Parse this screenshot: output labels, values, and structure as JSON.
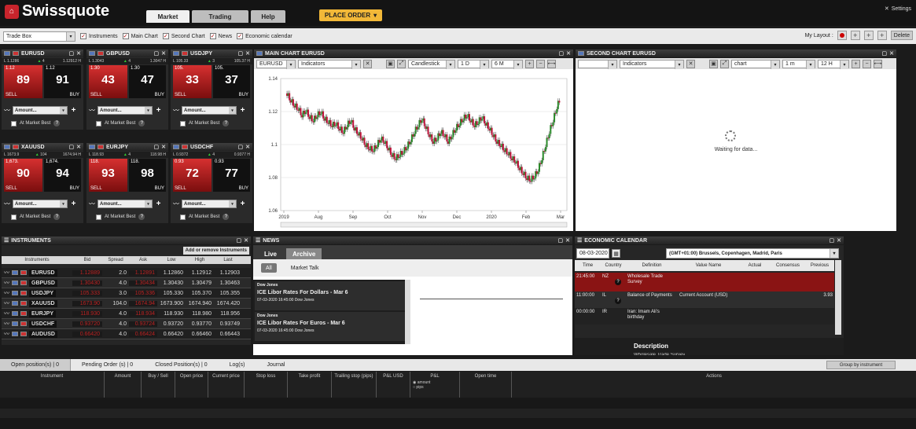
{
  "app": {
    "brand": "Swissquote",
    "settings": "Settings"
  },
  "nav": {
    "tabs": [
      "Market",
      "Trading",
      "Help"
    ],
    "place_order": "PLACE ORDER"
  },
  "toolbar": {
    "tradebox": "Trade Box",
    "checks": [
      "Instruments",
      "Main Chart",
      "Second Chart",
      "News",
      "Economic calendar"
    ],
    "my_layout": "My Layout :",
    "delete": "Delete"
  },
  "tiles": [
    {
      "pair": "EURUSD",
      "low": "L 1.1286",
      "mid": "4",
      "high": "1.12912 H",
      "sell_small": "1.12",
      "sell_big": "89",
      "buy_small": "1.12",
      "buy_big": "91",
      "sell": "SELL",
      "buy": "BUY",
      "amount": "Amount...",
      "mb": "At Market Best"
    },
    {
      "pair": "GBPUSD",
      "low": "L 1.3043",
      "mid": "4",
      "high": "1.3047 H",
      "sell_small": "1.30",
      "sell_big": "43",
      "buy_small": "1.30",
      "buy_big": "47",
      "sell": "SELL",
      "buy": "BUY",
      "amount": "Amount...",
      "mb": "At Market Best"
    },
    {
      "pair": "USDJPY",
      "low": "L 105.33",
      "mid": "3",
      "high": "105.37 H",
      "sell_small": "105.",
      "sell_big": "33",
      "buy_small": "105.",
      "buy_big": "37",
      "sell": "SELL",
      "buy": "BUY",
      "amount": "Amount...",
      "mb": "At Market Best"
    },
    {
      "pair": "XAUUSD",
      "low": "L 1673.9",
      "mid": "104",
      "high": "1674.94 H",
      "sell_small": "1,673.",
      "sell_big": "90",
      "buy_small": "1,674.",
      "buy_big": "94",
      "sell": "SELL",
      "buy": "BUY",
      "amount": "Amount...",
      "mb": "At Market Best"
    },
    {
      "pair": "EURJPY",
      "low": "L 118.93",
      "mid": "4",
      "high": "118.98 H",
      "sell_small": "118.",
      "sell_big": "93",
      "buy_small": "118.",
      "buy_big": "98",
      "sell": "SELL",
      "buy": "BUY",
      "amount": "Amount...",
      "mb": "At Market Best"
    },
    {
      "pair": "USDCHF",
      "low": "L 0.9372",
      "mid": "4",
      "high": "0.9377 H",
      "sell_small": "0.93",
      "sell_big": "72",
      "buy_small": "0.93",
      "buy_big": "77",
      "sell": "SELL",
      "buy": "BUY",
      "amount": "Amount...",
      "mb": "At Market Best"
    }
  ],
  "main_chart": {
    "title": "MAIN CHART EURUSD",
    "instrument": "EURUSD",
    "indicators": "Indicators",
    "type": "Candlestick",
    "interval": "1 D",
    "range": "6 M",
    "yticks": [
      "1.14",
      "1.12",
      "1.1",
      "1.08",
      "1.06"
    ],
    "xticks": [
      "2019",
      "Aug",
      "Sep",
      "Oct",
      "Nov",
      "Dec",
      "2020",
      "Feb",
      "Mar"
    ]
  },
  "second_chart": {
    "title": "SECOND CHART EURUSD",
    "indicators": "Indicators",
    "type": "chart",
    "interval": "1 m",
    "range": "12 H",
    "waiting": "Waiting for data..."
  },
  "instruments": {
    "title": "INSTRUMENTS",
    "add_remove": "Add or remove Instruments",
    "headers": [
      "Instruments",
      "Bid",
      "Spread",
      "Ask",
      "Low",
      "High",
      "Last"
    ],
    "rows": [
      [
        "EURUSD",
        "1.12889",
        "2.0",
        "1.12891",
        "1.12860",
        "1.12912",
        "1.12903"
      ],
      [
        "GBPUSD",
        "1.30430",
        "4.0",
        "1.30434",
        "1.30430",
        "1.30479",
        "1.30463"
      ],
      [
        "USDJPY",
        "105.333",
        "3.0",
        "105.336",
        "105.330",
        "105.370",
        "105.355"
      ],
      [
        "XAUUSD",
        "1673.90",
        "104.0",
        "1674.94",
        "1673.900",
        "1674.940",
        "1674.420"
      ],
      [
        "EURJPY",
        "118.930",
        "4.0",
        "118.934",
        "118.930",
        "118.980",
        "118.956"
      ],
      [
        "USDCHF",
        "0.93720",
        "4.0",
        "0.93724",
        "0.93720",
        "0.93770",
        "0.93749"
      ],
      [
        "AUDUSD",
        "0.66420",
        "4.0",
        "0.66424",
        "0.66420",
        "0.66460",
        "0.66443"
      ]
    ]
  },
  "news": {
    "title": "NEWS",
    "tabs": [
      "Live",
      "Archive"
    ],
    "filters": [
      "All",
      "Market Talk"
    ],
    "items": [
      {
        "source": "Dow Jones",
        "headline": "ICE Libor Rates For Dollars - Mar 6",
        "meta": "07-03-2020 16:45:00  Dow Jones"
      },
      {
        "source": "Dow Jones",
        "headline": "ICE Libor Rates For Euros - Mar 6",
        "meta": "07-03-2020 16:45:00  Dow Jones"
      }
    ]
  },
  "calendar": {
    "title": "ECONOMIC CALENDAR",
    "date": "08-03-2020",
    "timezone": "(GMT+01:00) Brussels, Copenhagen, Madrid, Paris",
    "headers": [
      "Time",
      "Country",
      "Definition",
      "Value Name",
      "Actual",
      "Consensus",
      "Previous"
    ],
    "rows": [
      {
        "time": "21:45:00",
        "country": "NZ",
        "definition": "Wholesale Trade Survey",
        "value": "",
        "actual": "",
        "consensus": "",
        "previous": "",
        "q": "?"
      },
      {
        "time": "11:00:00",
        "country": "IL",
        "definition": "Balance of Payments",
        "value": "Current Account (USD)",
        "actual": "",
        "consensus": "",
        "previous": "3.93",
        "q": "?"
      },
      {
        "time": "00:00:00",
        "country": "IR",
        "definition": "Iran: Imam Ali's birthday",
        "value": "",
        "actual": "",
        "consensus": "",
        "previous": "",
        "q": ""
      }
    ],
    "description_title": "Description",
    "description_text": "Wholesale Trade Survey"
  },
  "positions": {
    "tabs": [
      "Open position(s) | 0",
      "Pending Order (s) | 0",
      "Closed Position(s) | 0",
      "Log(s)",
      "Journal"
    ],
    "group": "Group by instrument",
    "headers": [
      "Instrument",
      "Amount",
      "Buy / Sell",
      "Open price",
      "Current price",
      "Stop loss",
      "Take profit",
      "Trailing stop (pips)",
      "P&L USD",
      "P&L",
      "Open time",
      "Actions"
    ],
    "pl_options": [
      "amount",
      "pips"
    ]
  },
  "chart_data": {
    "type": "candlestick",
    "ylim": [
      1.06,
      1.14
    ],
    "xlabels": [
      "2019",
      "Aug",
      "Sep",
      "Oct",
      "Nov",
      "Dec",
      "2020",
      "Feb",
      "Mar"
    ],
    "values": [
      1.131,
      1.127,
      1.124,
      1.122,
      1.118,
      1.121,
      1.117,
      1.115,
      1.118,
      1.12,
      1.116,
      1.114,
      1.112,
      1.113,
      1.11,
      1.108,
      1.112,
      1.115,
      1.11,
      1.107,
      1.104,
      1.1,
      1.098,
      1.097,
      1.1,
      1.104,
      1.102,
      1.098,
      1.094,
      1.092,
      1.094,
      1.096,
      1.099,
      1.103,
      1.108,
      1.112,
      1.116,
      1.111,
      1.106,
      1.102,
      1.104,
      1.108,
      1.106,
      1.102,
      1.106,
      1.11,
      1.113,
      1.116,
      1.118,
      1.115,
      1.112,
      1.114,
      1.117,
      1.113,
      1.11,
      1.106,
      1.102,
      1.1,
      1.097,
      1.095,
      1.092,
      1.09,
      1.086,
      1.083,
      1.08,
      1.079,
      1.081,
      1.085,
      1.092,
      1.1,
      1.108,
      1.115,
      1.123,
      1.129
    ]
  }
}
